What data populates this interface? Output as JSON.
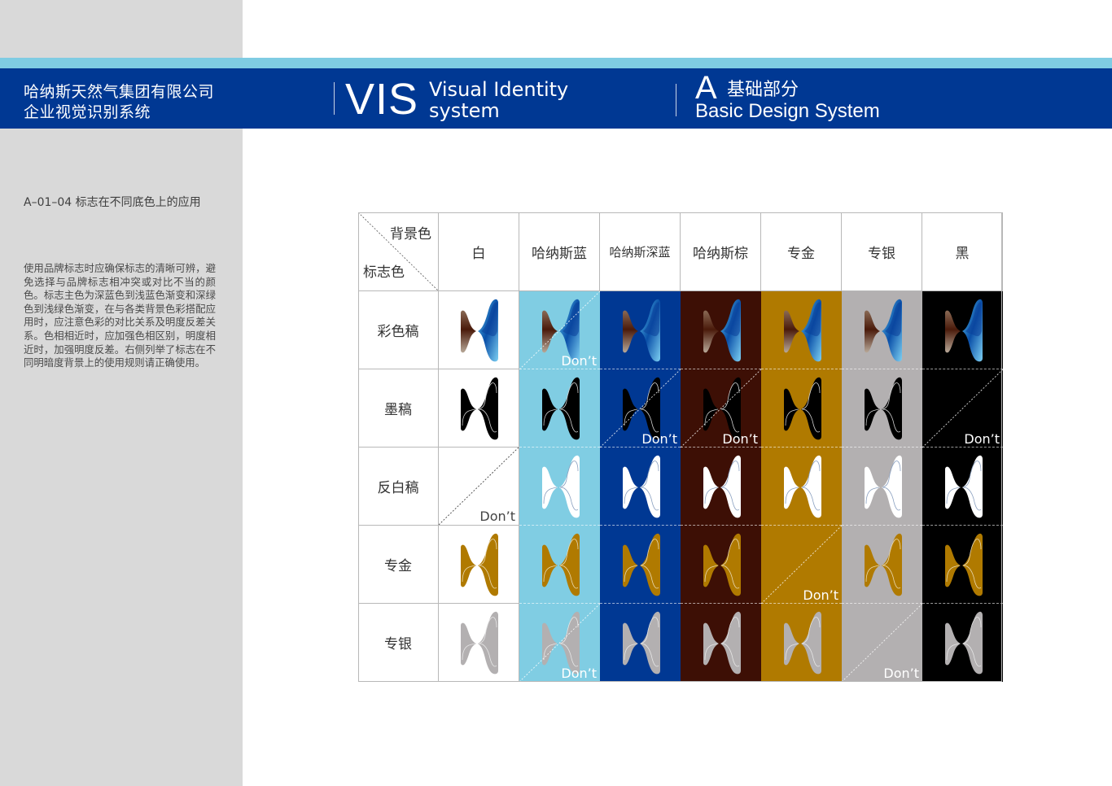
{
  "header": {
    "company_line1": "哈纳斯天然气集团有限公司",
    "company_line2": "企业视觉识别系统",
    "vis_big": "VIS",
    "vis_line1": "Visual Identity",
    "vis_line2": "system",
    "section_letter": "A",
    "section_cn": "基础部分",
    "section_en": "Basic Design System"
  },
  "sidebar": {
    "code_title": "A–01–04 标志在不同底色上的应用",
    "description": "使用品牌标志时应确保标志的清晰可辨，避免选择与品牌标志相冲突或对比不当的颜色。标志主色为深蓝色到浅蓝色渐变和深绿色到浅绿色渐变，在与各类背景色彩搭配应用时，应注意色彩的对比关系及明度反差关系。色相相近时，应加强色相区别，明度相近时，加强明度反差。右侧列举了标志在不同明暗度背景上的使用规则请正确使用。"
  },
  "colors": {
    "header_blue": "#003893",
    "band_light_blue": "#7fcce3",
    "sidebar_gray": "#d9d9d9"
  },
  "table": {
    "corner_bg_label": "背景色",
    "corner_logo_label": "标志色",
    "dont_label": "Don’t",
    "columns": [
      {
        "label": "白",
        "bg": "#ffffff",
        "dont_text": "#444444"
      },
      {
        "label": "哈纳斯蓝",
        "bg": "#80cde3",
        "dont_text": "#ffffff"
      },
      {
        "label": "哈纳斯深蓝",
        "bg": "#003893",
        "dont_text": "#ffffff"
      },
      {
        "label": "哈纳斯棕",
        "bg": "#3d0f05",
        "dont_text": "#ffffff"
      },
      {
        "label": "专金",
        "bg": "#b07a00",
        "dont_text": "#ffffff"
      },
      {
        "label": "专银",
        "bg": "#b3b0b1",
        "dont_text": "#ffffff"
      },
      {
        "label": "黑",
        "bg": "#000000",
        "dont_text": "#ffffff"
      }
    ],
    "rows": [
      {
        "label": "彩色稿",
        "logo_type": "color",
        "fill": "",
        "stroke": "",
        "cells": [
          {
            "status": "ok",
            "show_logo": true
          },
          {
            "status": "dont",
            "show_logo": true
          },
          {
            "status": "ok",
            "show_logo": true
          },
          {
            "status": "ok",
            "show_logo": true
          },
          {
            "status": "ok",
            "show_logo": true
          },
          {
            "status": "ok",
            "show_logo": true
          },
          {
            "status": "ok",
            "show_logo": true
          }
        ]
      },
      {
        "label": "墨稿",
        "logo_type": "mono",
        "fill": "#000000",
        "stroke": "#cfcfcf",
        "cells": [
          {
            "status": "ok",
            "show_logo": true
          },
          {
            "status": "ok",
            "show_logo": true
          },
          {
            "status": "dont",
            "show_logo": true
          },
          {
            "status": "dont",
            "show_logo": true
          },
          {
            "status": "ok",
            "show_logo": true
          },
          {
            "status": "ok",
            "show_logo": true
          },
          {
            "status": "dont",
            "show_logo": false
          }
        ]
      },
      {
        "label": "反白稿",
        "logo_type": "mono",
        "fill": "#ffffff",
        "stroke": "#8aa0c0",
        "cells": [
          {
            "status": "dont",
            "show_logo": false
          },
          {
            "status": "ok",
            "show_logo": true
          },
          {
            "status": "ok",
            "show_logo": true
          },
          {
            "status": "ok",
            "show_logo": true
          },
          {
            "status": "ok",
            "show_logo": true
          },
          {
            "status": "ok",
            "show_logo": true
          },
          {
            "status": "ok",
            "show_logo": true
          }
        ]
      },
      {
        "label": "专金",
        "logo_type": "mono",
        "fill": "#b07a00",
        "stroke": "#e8d8b0",
        "cells": [
          {
            "status": "ok",
            "show_logo": true
          },
          {
            "status": "ok",
            "show_logo": true
          },
          {
            "status": "ok",
            "show_logo": true
          },
          {
            "status": "ok",
            "show_logo": true
          },
          {
            "status": "dont",
            "show_logo": false
          },
          {
            "status": "ok",
            "show_logo": true
          },
          {
            "status": "ok",
            "show_logo": true
          }
        ]
      },
      {
        "label": "专银",
        "logo_type": "mono",
        "fill": "#b3b0b1",
        "stroke": "#e6e6e6",
        "cells": [
          {
            "status": "ok",
            "show_logo": true
          },
          {
            "status": "dont",
            "show_logo": true
          },
          {
            "status": "ok",
            "show_logo": true
          },
          {
            "status": "ok",
            "show_logo": true
          },
          {
            "status": "ok",
            "show_logo": true
          },
          {
            "status": "dont",
            "show_logo": false
          },
          {
            "status": "ok",
            "show_logo": true
          }
        ]
      }
    ]
  }
}
